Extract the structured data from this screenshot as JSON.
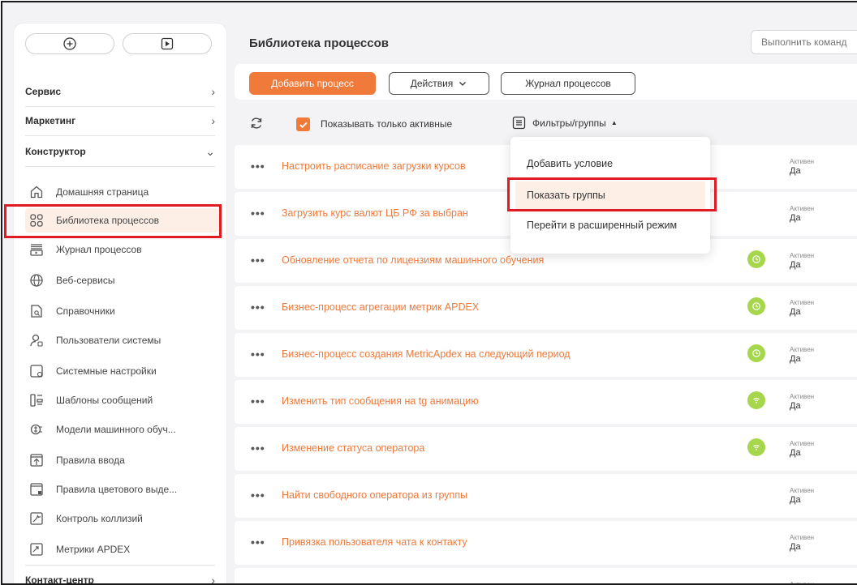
{
  "colors": {
    "accent": "#f07a3a",
    "highlight": "#e01b24",
    "status_badge": "#a6d64b"
  },
  "sidebar": {
    "sections": [
      {
        "label": "Сервис",
        "expanded": false
      },
      {
        "label": "Маркетинг",
        "expanded": false
      },
      {
        "label": "Конструктор",
        "expanded": true
      },
      {
        "label": "Контакт-центр",
        "expanded": false
      }
    ],
    "items": [
      {
        "label": "Домашняя страница",
        "icon": "home-icon"
      },
      {
        "label": "Библиотека процессов",
        "icon": "process-library-icon"
      },
      {
        "label": "Журнал процессов",
        "icon": "process-log-icon"
      },
      {
        "label": "Веб-сервисы",
        "icon": "globe-icon"
      },
      {
        "label": "Справочники",
        "icon": "lookup-icon"
      },
      {
        "label": "Пользователи системы",
        "icon": "users-icon"
      },
      {
        "label": "Системные настройки",
        "icon": "settings-icon"
      },
      {
        "label": "Шаблоны сообщений",
        "icon": "templates-icon"
      },
      {
        "label": "Модели машинного обуч...",
        "icon": "ml-model-icon"
      },
      {
        "label": "Правила ввода",
        "icon": "input-rules-icon"
      },
      {
        "label": "Правила цветового выде...",
        "icon": "color-rules-icon"
      },
      {
        "label": "Контроль коллизий",
        "icon": "collision-icon"
      },
      {
        "label": "Метрики APDEX",
        "icon": "metrics-icon"
      }
    ],
    "active_item": "Библиотека процессов"
  },
  "header": {
    "title": "Библиотека процессов",
    "command_placeholder": "Выполнить команд"
  },
  "toolbar": {
    "add_label": "Добавить процесс",
    "actions_label": "Действия",
    "journal_label": "Журнал процессов"
  },
  "filterbar": {
    "show_active_label": "Показывать только активные",
    "show_active_checked": true,
    "filters_label": "Фильтры/группы"
  },
  "dropdown": {
    "items": [
      "Добавить условие",
      "Показать группы",
      "Перейти в расширенный режим"
    ],
    "hovered": "Показать группы"
  },
  "rows": [
    {
      "name": "Настроить расписание загрузки курсов",
      "status_label": "Активен",
      "status_value": "Да",
      "badge": "none"
    },
    {
      "name": "Загрузить курс валют ЦБ РФ за выбран",
      "status_label": "Активен",
      "status_value": "Да",
      "badge": "none"
    },
    {
      "name": "Обновление отчета по лицензиям машинного обучения",
      "status_label": "Активен",
      "status_value": "Да",
      "badge": "clock-icon"
    },
    {
      "name": "Бизнес-процесс агрегации метрик APDEX",
      "status_label": "Активен",
      "status_value": "Да",
      "badge": "clock-icon"
    },
    {
      "name": "Бизнес-процесс создания MetricApdex на следующий период",
      "status_label": "Активен",
      "status_value": "Да",
      "badge": "clock-icon"
    },
    {
      "name": "Изменить тип сообщения на tg анимацию",
      "status_label": "Активен",
      "status_value": "Да",
      "badge": "signal-icon"
    },
    {
      "name": "Изменение статуса оператора",
      "status_label": "Активен",
      "status_value": "Да",
      "badge": "signal-icon"
    },
    {
      "name": "Найти свободного оператора из группы",
      "status_label": "Активен",
      "status_value": "Да",
      "badge": "none"
    },
    {
      "name": "Привязка пользователя чата к контакту",
      "status_label": "Активен",
      "status_value": "Да",
      "badge": "none"
    },
    {
      "name": "",
      "status_label": "Активен",
      "status_value": "",
      "badge": "none"
    }
  ]
}
